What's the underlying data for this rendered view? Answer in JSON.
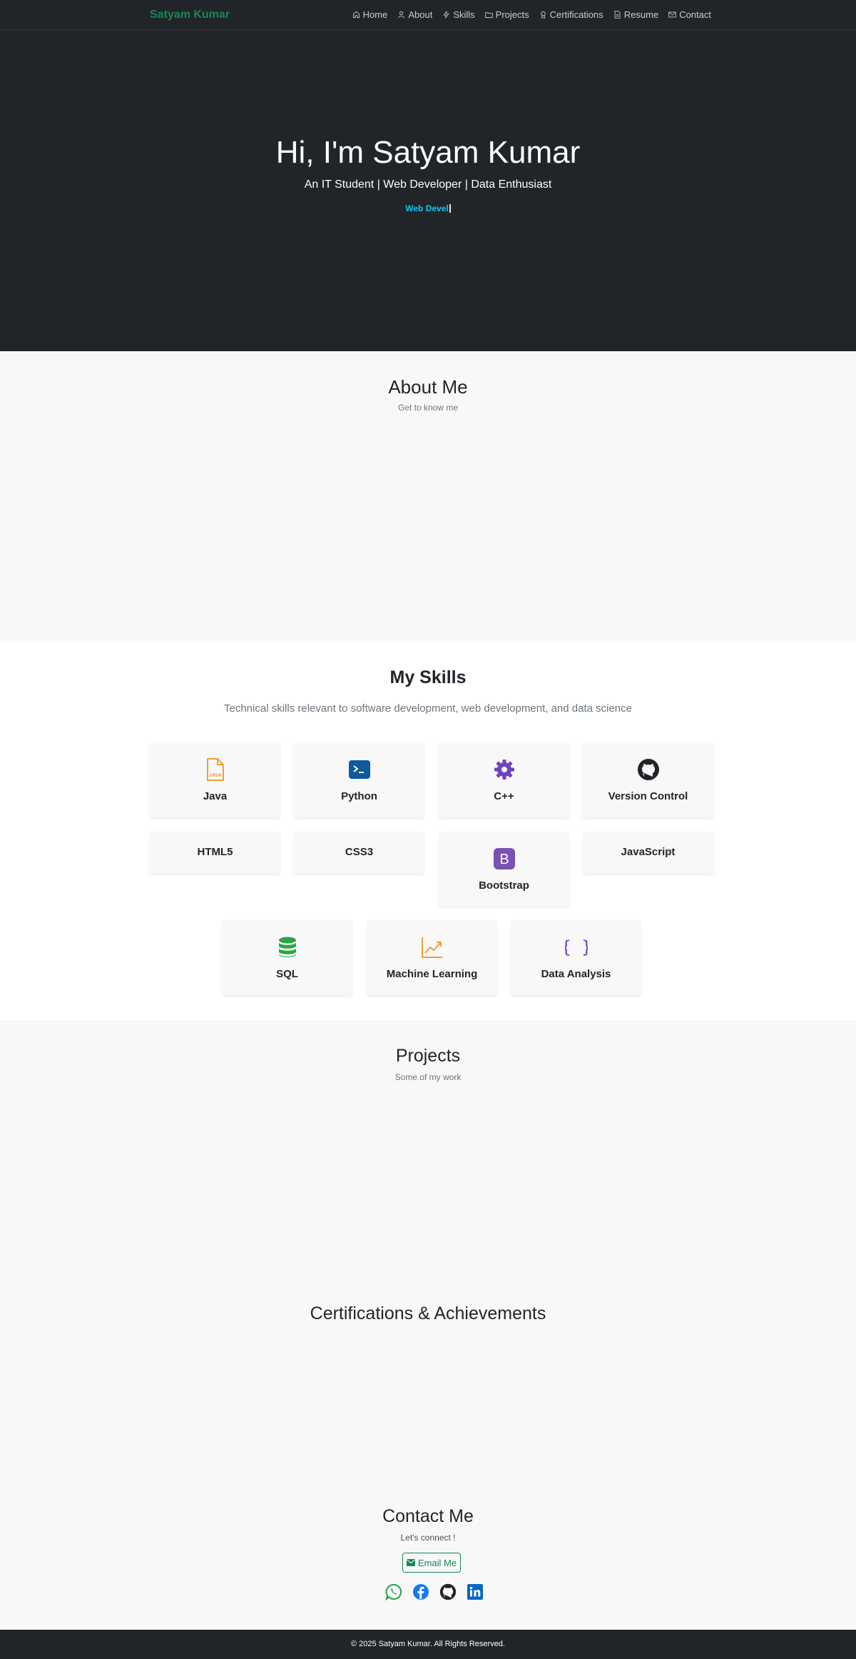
{
  "nav": {
    "brand": "Satyam Kumar",
    "links": [
      {
        "label": "Home",
        "icon": "home-icon"
      },
      {
        "label": "About",
        "icon": "user-icon"
      },
      {
        "label": "Skills",
        "icon": "lightning-icon"
      },
      {
        "label": "Projects",
        "icon": "folder-icon"
      },
      {
        "label": "Certifications",
        "icon": "award-icon"
      },
      {
        "label": "Resume",
        "icon": "file-icon"
      },
      {
        "label": "Contact",
        "icon": "envelope-icon"
      }
    ]
  },
  "hero": {
    "title": "Hi, I'm Satyam Kumar",
    "subtitle": "An IT Student | Web Developer | Data Enthusiast",
    "typed_text": "Web Devel"
  },
  "about": {
    "title": "About Me",
    "subtitle": "Get to know me"
  },
  "skills": {
    "title": "My Skills",
    "subtitle": "Technical skills relevant to software development, web development, and data science",
    "items": [
      {
        "label": "Java",
        "icon": "java-file-icon",
        "color": "#f0a030"
      },
      {
        "label": "Python",
        "icon": "terminal-icon",
        "color": "#0d5a9c"
      },
      {
        "label": "C++",
        "icon": "gear-icon",
        "color": "#6f42c1"
      },
      {
        "label": "Version Control",
        "icon": "github-icon",
        "color": "#212529"
      },
      {
        "label": "HTML5",
        "icon": "",
        "color": ""
      },
      {
        "label": "CSS3",
        "icon": "",
        "color": ""
      },
      {
        "label": "Bootstrap",
        "icon": "bootstrap-icon",
        "color": "#7952b3"
      },
      {
        "label": "JavaScript",
        "icon": "",
        "color": ""
      },
      {
        "label": "SQL",
        "icon": "database-icon",
        "color": "#28a745"
      },
      {
        "label": "Machine Learning",
        "icon": "chart-line-icon",
        "color": "#f0a030"
      },
      {
        "label": "Data Analysis",
        "icon": "braces-icon",
        "color": "#6f42c1"
      }
    ]
  },
  "projects": {
    "title": "Projects",
    "subtitle": "Some of my work"
  },
  "certifications": {
    "title": "Certifications & Achievements"
  },
  "contact": {
    "title": "Contact Me",
    "subtitle": "Let's connect !",
    "email_label": "Email Me",
    "socials": [
      {
        "icon": "whatsapp-icon",
        "color": "#25d366"
      },
      {
        "icon": "facebook-icon",
        "color": "#1877f2"
      },
      {
        "icon": "github-icon",
        "color": "#212529"
      },
      {
        "icon": "linkedin-icon",
        "color": "#0a66c2"
      }
    ]
  },
  "footer": {
    "text": "© 2025 Satyam Kumar. All Rights Reserved."
  }
}
